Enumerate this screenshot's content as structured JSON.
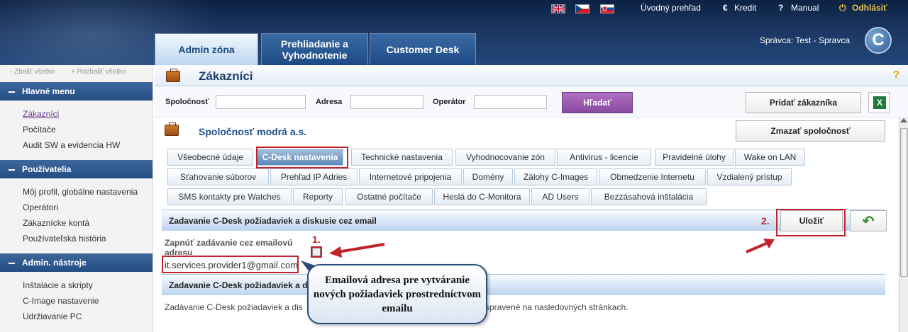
{
  "topnav": {
    "home": "Úvodný prehľad",
    "credit": "Kredit",
    "manual": "Manual",
    "logout": "Odhlásiť",
    "credit_icon": "euro-icon",
    "manual_icon": "question-icon",
    "logout_icon": "power-icon"
  },
  "tabs": [
    {
      "label": "Admin zóna"
    },
    {
      "label": "Prehliadanie a Vyhodnotenie"
    },
    {
      "label": "Customer Desk"
    }
  ],
  "user": {
    "prefix": "Správca:",
    "name": "Test - Spravca"
  },
  "logo": {
    "letter": "C"
  },
  "sidebar": {
    "collapse_all": "Zbaliť všetko",
    "expand_all": "Rozbaliť všetko",
    "sections": [
      {
        "title": "Hlavné menu",
        "items": [
          "Zákazníci",
          "Počítače",
          "Audit SW a evidencia HW"
        ]
      },
      {
        "title": "Používatelia",
        "items": [
          "Môj profil, globálne nastavenia",
          "Operátori",
          "Zákaznícke kontá",
          "Používateľská história"
        ]
      },
      {
        "title": "Admin. nástroje",
        "items": [
          "Inštalácie a skripty",
          "C-Image nastavenie",
          "Udržiavanie PC"
        ]
      }
    ]
  },
  "page": {
    "title": "Zákazníci",
    "help": "?"
  },
  "filter": {
    "company_label": "Spoločnosť",
    "address_label": "Adresa",
    "operator_label": "Operátor",
    "search_button": "Hľadať",
    "add_customer_button": "Pridať zákazníka"
  },
  "company": {
    "name": "Spoločnosť modrá a.s.",
    "delete_button": "Zmazať spoločnosť"
  },
  "subtabs": [
    "Všeobecné údaje",
    "C-Desk nastavenia",
    "Technické nastavenia",
    "Vyhodnocovanie zón",
    "Antivirus - licencie",
    "Pravidelné úlohy",
    "Wake on LAN",
    "Sťahovanie súborov",
    "Prehľad IP Adries",
    "Internetové pripojenia",
    "Domény",
    "Zálohy C-Images",
    "Obmedzenie Internetu",
    "Vzdialený prístup",
    "SMS kontakty pre Watches",
    "Reporty",
    "Ostatné počítače",
    "Heslá do C-Monitora",
    "AD Users",
    "Bezzásahová inštalácia"
  ],
  "section1": {
    "title": "Zadavanie C-Desk požiadaviek a diskusie cez email",
    "save_button": "Uložiť"
  },
  "form": {
    "enable_label": "Zapnúť zadávanie cez emailovú adresu",
    "email": "it.services.provider1@gmail.com"
  },
  "section2": {
    "title": "Zadavanie C-Desk požiadaviek a di"
  },
  "desc": {
    "left": "Zadávanie C-Desk požiadaviek a dis",
    "right": "spravené na nasledovných stránkach."
  },
  "annotations": {
    "n1": "1.",
    "n2": "2.",
    "callout": "Emailová adresa pre vytváranie nových požiadaviek prostredníctvom emailu",
    "color": "#c0242b"
  }
}
